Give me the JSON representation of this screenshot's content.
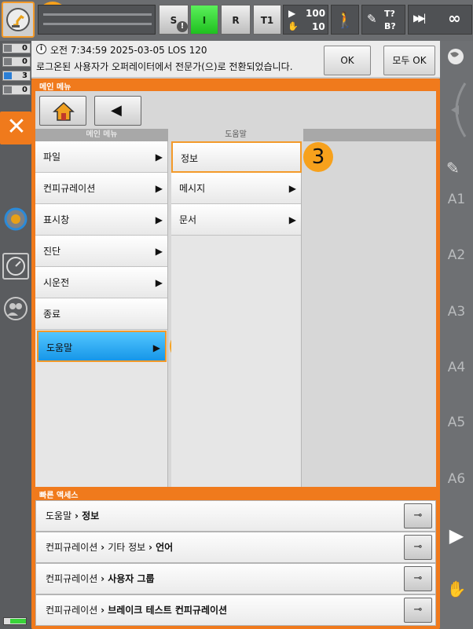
{
  "topbar": {
    "s_label": "S",
    "i_label": "I",
    "r_label": "R",
    "t1_label": "T1",
    "override_prog": "100",
    "override_jog": "10",
    "tool_label": "T?",
    "base_label": "B?",
    "infinity": "∞"
  },
  "counters": [
    "0",
    "0",
    "3",
    "0"
  ],
  "message": {
    "time_line": "오전 7:34:59 2025-03-05 LOS 120",
    "text": "로그온된 사용자가 오퍼레이터에서 전문가(으)로 전환되었습니다.",
    "ok_label": "OK",
    "all_ok_label": "모두 OK"
  },
  "menu": {
    "title": "메인 메뉴",
    "col1_header": "메인 메뉴",
    "col2_header": "도움말",
    "col1_items": [
      {
        "label": "파일",
        "arrow": "▶"
      },
      {
        "label": "컨피규레이션",
        "arrow": "▶"
      },
      {
        "label": "표시창",
        "arrow": "▶"
      },
      {
        "label": "진단",
        "arrow": "▶"
      },
      {
        "label": "시운전",
        "arrow": "▶"
      },
      {
        "label": "종료",
        "arrow": ""
      },
      {
        "label": "도움말",
        "arrow": "▶"
      }
    ],
    "col2_items": [
      {
        "label": "정보",
        "arrow": ""
      },
      {
        "label": "메시지",
        "arrow": "▶"
      },
      {
        "label": "문서",
        "arrow": "▶"
      }
    ],
    "back_glyph": "◀"
  },
  "quick_access": {
    "title": "빠른 액세스",
    "rows": [
      {
        "prefix": "도움말 ",
        "sep1": "› ",
        "part2": "정보",
        "sep2": "",
        "part3": ""
      },
      {
        "prefix": "컨피규레이션 ",
        "sep1": "› ",
        "part2": "기타 정보 ",
        "sep2": "› ",
        "part3": "언어"
      },
      {
        "prefix": "컨피규레이션 ",
        "sep1": "› ",
        "part2": "사용자 그룹",
        "sep2": "",
        "part3": ""
      },
      {
        "prefix": "컨피규레이션 ",
        "sep1": "› ",
        "part2": "브레이크 테스트 컨피규레이션",
        "sep2": "",
        "part3": ""
      }
    ]
  },
  "axes": [
    "A1",
    "A2",
    "A3",
    "A4",
    "A5",
    "A6"
  ],
  "badges": [
    "1",
    "2",
    "3"
  ],
  "colors": {
    "accent": "#f07a1c",
    "selected": "#1696e8",
    "badge": "#f7a11c"
  }
}
